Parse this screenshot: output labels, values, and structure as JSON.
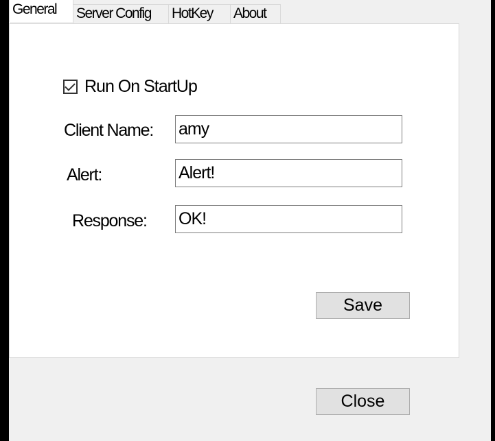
{
  "tabs": [
    {
      "label": "General",
      "active": true
    },
    {
      "label": "Server Config",
      "active": false
    },
    {
      "label": "HotKey",
      "active": false
    },
    {
      "label": "About",
      "active": false
    }
  ],
  "general": {
    "run_on_startup": {
      "label": "Run On StartUp",
      "checked": true
    },
    "client_name": {
      "label": "Client Name:",
      "value": "amy"
    },
    "alert": {
      "label": "Alert:",
      "value": "Alert!"
    },
    "response": {
      "label": "Response:",
      "value": "OK!"
    },
    "save_label": "Save"
  },
  "footer": {
    "close_label": "Close"
  },
  "colors": {
    "background": "#000000",
    "window": "#f0f0f0",
    "panel": "#ffffff",
    "button": "#e1e1e1"
  },
  "icons": {
    "checkbox": "check-icon"
  }
}
